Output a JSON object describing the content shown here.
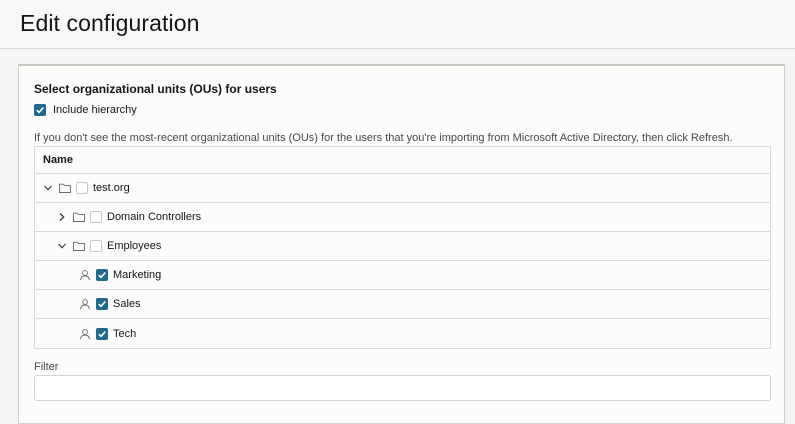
{
  "header": {
    "title": "Edit configuration"
  },
  "section": {
    "title": "Select organizational units (OUs) for users",
    "include_hierarchy": {
      "label": "Include hierarchy",
      "checked": true
    },
    "info": "If you don't see the most-recent organizational units (OUs) for the users that you're importing from Microsoft Active Directory, then click Refresh."
  },
  "table": {
    "header": "Name",
    "rows": [
      {
        "label": "test.org",
        "level": 0,
        "expander": "expanded",
        "icon": "folder-icon",
        "checked": false
      },
      {
        "label": "Domain Controllers",
        "level": 1,
        "expander": "collapsed",
        "icon": "folder-icon",
        "checked": false
      },
      {
        "label": "Employees",
        "level": 1,
        "expander": "expanded",
        "icon": "folder-icon",
        "checked": false
      },
      {
        "label": "Marketing",
        "level": 2,
        "expander": "none",
        "icon": "user-icon",
        "checked": true
      },
      {
        "label": "Sales",
        "level": 2,
        "expander": "none",
        "icon": "user-icon",
        "checked": true
      },
      {
        "label": "Tech",
        "level": 2,
        "expander": "none",
        "icon": "user-icon",
        "checked": true
      }
    ]
  },
  "filter": {
    "label": "Filter",
    "value": "",
    "placeholder": ""
  },
  "colors": {
    "accent": "#1f6b8f",
    "border": "#dcdad6",
    "background": "#f5f4f2"
  }
}
